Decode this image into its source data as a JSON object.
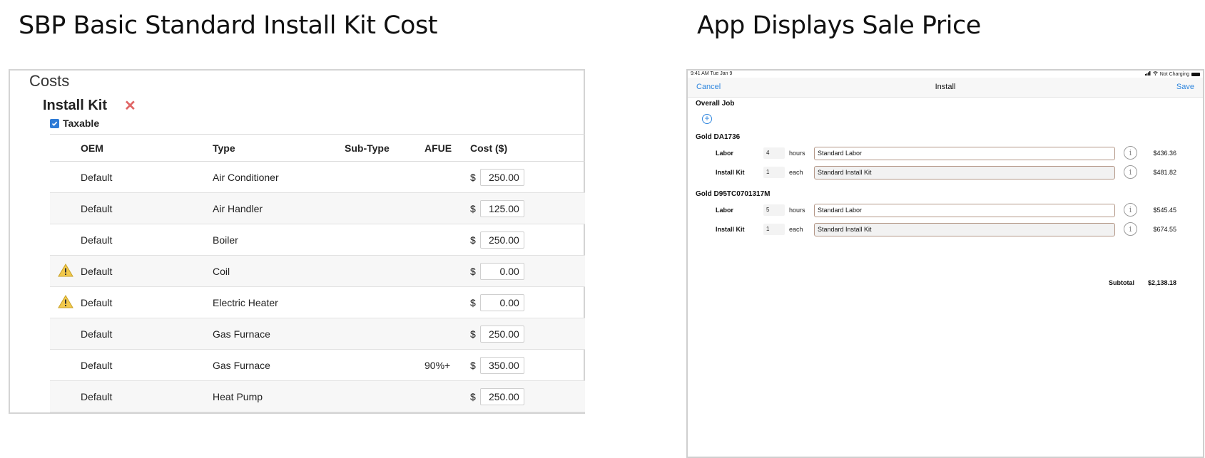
{
  "slide": {
    "left_title": "SBP Basic Standard Install Kit Cost",
    "right_title": "App Displays Sale Price"
  },
  "costs_panel": {
    "heading": "Costs",
    "kit_title": "Install Kit",
    "remove_symbol": "✕",
    "taxable_label": "Taxable",
    "taxable_checked": true,
    "columns": [
      "OEM",
      "Type",
      "Sub-Type",
      "AFUE",
      "Cost ($)"
    ],
    "currency_symbol": "$",
    "rows": [
      {
        "warning": false,
        "oem": "Default",
        "type": "Air Conditioner",
        "subtype": "",
        "afue": "",
        "cost": "250.00"
      },
      {
        "warning": false,
        "oem": "Default",
        "type": "Air Handler",
        "subtype": "",
        "afue": "",
        "cost": "125.00"
      },
      {
        "warning": false,
        "oem": "Default",
        "type": "Boiler",
        "subtype": "",
        "afue": "",
        "cost": "250.00"
      },
      {
        "warning": true,
        "oem": "Default",
        "type": "Coil",
        "subtype": "",
        "afue": "",
        "cost": "0.00"
      },
      {
        "warning": true,
        "oem": "Default",
        "type": "Electric Heater",
        "subtype": "",
        "afue": "",
        "cost": "0.00"
      },
      {
        "warning": false,
        "oem": "Default",
        "type": "Gas Furnace",
        "subtype": "",
        "afue": "",
        "cost": "250.00"
      },
      {
        "warning": false,
        "oem": "Default",
        "type": "Gas Furnace",
        "subtype": "",
        "afue": "90%+",
        "cost": "350.00"
      },
      {
        "warning": false,
        "oem": "Default",
        "type": "Heat Pump",
        "subtype": "",
        "afue": "",
        "cost": "250.00"
      }
    ]
  },
  "app": {
    "status": {
      "time": "9:41 AM   Tue Jan 9",
      "right": "Not Charging"
    },
    "nav": {
      "cancel": "Cancel",
      "title": "Install",
      "save": "Save"
    },
    "overall_job_label": "Overall Job",
    "add_symbol": "+",
    "info_symbol": "i",
    "groups": [
      {
        "name": "Gold DA1736",
        "lines": [
          {
            "label": "Labor",
            "qty": "4",
            "unit": "hours",
            "description": "Standard Labor",
            "price": "$436.36"
          },
          {
            "label": "Install Kit",
            "qty": "1",
            "unit": "each",
            "description": "Standard Install Kit",
            "price": "$481.82"
          }
        ]
      },
      {
        "name": "Gold D95TC0701317M",
        "lines": [
          {
            "label": "Labor",
            "qty": "5",
            "unit": "hours",
            "description": "Standard Labor",
            "price": "$545.45"
          },
          {
            "label": "Install Kit",
            "qty": "1",
            "unit": "each",
            "description": "Standard Install Kit",
            "price": "$674.55"
          }
        ]
      }
    ],
    "subtotal_label": "Subtotal",
    "subtotal_value": "$2,138.18"
  },
  "colors": {
    "accent": "#2f86de",
    "remove": "#e06666",
    "warning": "#f2c94c"
  }
}
